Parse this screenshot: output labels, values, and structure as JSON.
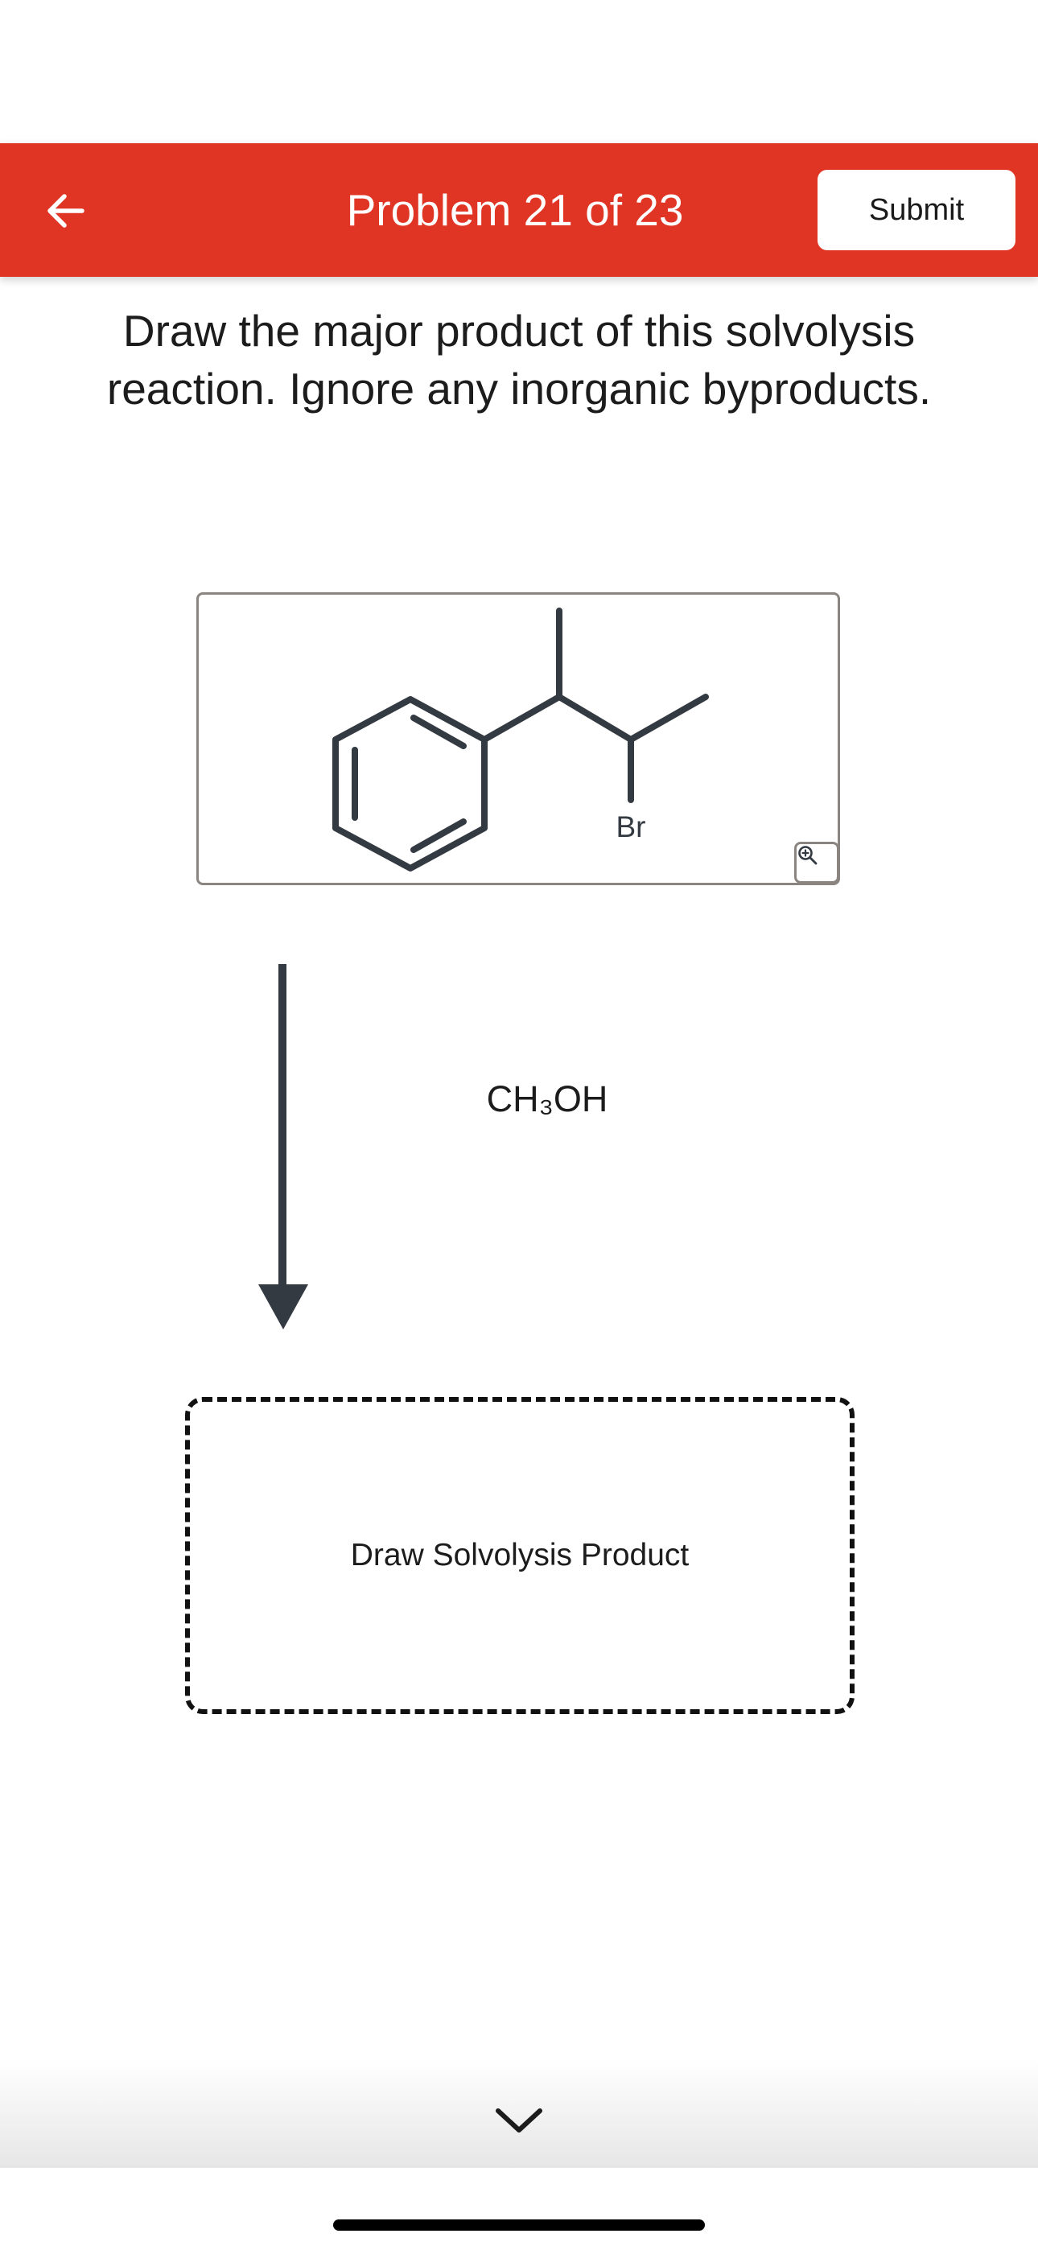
{
  "header": {
    "title": "Problem 21 of 23",
    "submit_label": "Submit",
    "back_icon": "arrow-left-icon",
    "color": "#e03524"
  },
  "question": {
    "text": "Draw the major product of this solvolysis reaction. Ignore any inorganic byproducts."
  },
  "reactant": {
    "atom_label": "Br",
    "zoom_icon": "zoom-in-icon"
  },
  "reaction": {
    "reagent": "CH₃OH"
  },
  "product": {
    "placeholder": "Draw Solvolysis Product"
  },
  "footer": {
    "expand_icon": "chevron-down-icon"
  }
}
